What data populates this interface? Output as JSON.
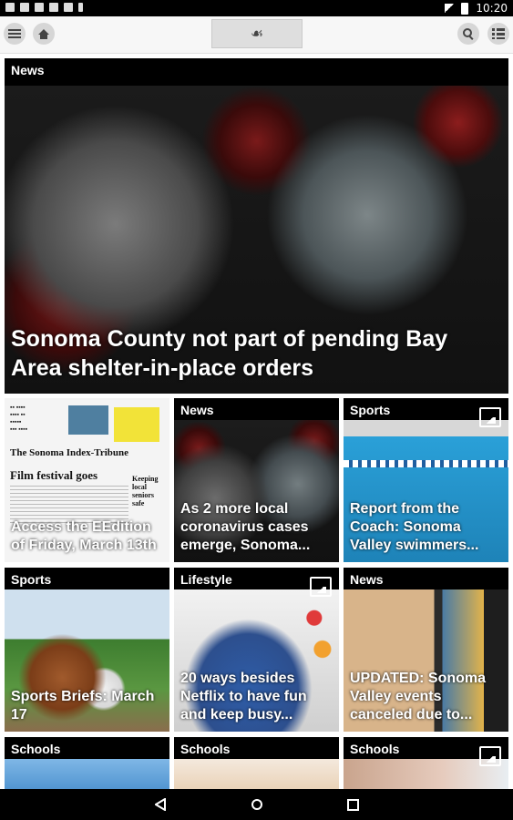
{
  "status_bar": {
    "time": "10:20"
  },
  "top_bar": {
    "logo_glyph": "☙"
  },
  "feed": {
    "featured": {
      "section": "News",
      "headline": "Sonoma County not part of pending Bay Area shelter-in-place orders"
    },
    "cards": [
      {
        "section": "",
        "headline": "Access the EEdition of Friday, March 13th"
      },
      {
        "section": "News",
        "headline": "As 2 more local coronavirus cases emerge, Sonoma..."
      },
      {
        "section": "Sports",
        "headline": "Report from the Coach: Sonoma Valley swimmers...",
        "gallery": true
      },
      {
        "section": "Sports",
        "headline": "Sports Briefs: March 17"
      },
      {
        "section": "Lifestyle",
        "headline": "20 ways besides Netflix to have fun and keep busy...",
        "gallery": true
      },
      {
        "section": "News",
        "headline": "UPDATED: Sonoma Valley events canceled due to..."
      },
      {
        "section": "Schools",
        "headline": ""
      },
      {
        "section": "Schools",
        "headline": ""
      },
      {
        "section": "Schools",
        "headline": "",
        "gallery": true
      }
    ]
  },
  "newspaper_preview": {
    "masthead": "The Sonoma Index-Tribune",
    "headline": "Film festival goes dark",
    "side_note": "Keeping local seniors safe"
  }
}
